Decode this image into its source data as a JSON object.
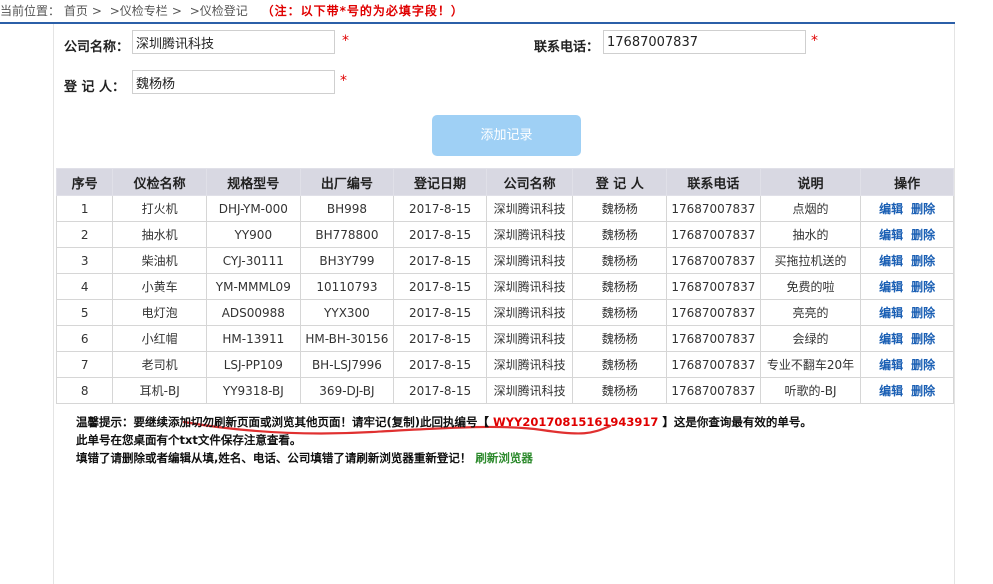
{
  "breadcrumb": {
    "label": "当前位置：",
    "items": [
      "首页",
      ">仪检专栏",
      ">仪检登记"
    ],
    "note": "（注：以下带*号的为必填字段！）"
  },
  "form": {
    "company_label": "公司名称：",
    "company_value": "深圳腾讯科技",
    "phone_label": "联系电话：",
    "phone_value": "17687007837",
    "registrant_label": "登 记 人：",
    "registrant_value": "魏杨杨",
    "required_mark": "*",
    "add_button": "添加记录"
  },
  "table": {
    "headers": [
      "序号",
      "仪检名称",
      "规格型号",
      "出厂编号",
      "登记日期",
      "公司名称",
      "登 记 人",
      "联系电话",
      "说明",
      "操作"
    ],
    "edit_label": "编辑",
    "delete_label": "删除",
    "rows": [
      [
        "1",
        "打火机",
        "DHJ-YM-000",
        "BH998",
        "2017-8-15",
        "深圳腾讯科技",
        "魏杨杨",
        "17687007837",
        "点烟的"
      ],
      [
        "2",
        "抽水机",
        "YY900",
        "BH778800",
        "2017-8-15",
        "深圳腾讯科技",
        "魏杨杨",
        "17687007837",
        "抽水的"
      ],
      [
        "3",
        "柴油机",
        "CYJ-30111",
        "BH3Y799",
        "2017-8-15",
        "深圳腾讯科技",
        "魏杨杨",
        "17687007837",
        "买拖拉机送的"
      ],
      [
        "4",
        "小黄车",
        "YM-MMML09",
        "10110793",
        "2017-8-15",
        "深圳腾讯科技",
        "魏杨杨",
        "17687007837",
        "免费的啦"
      ],
      [
        "5",
        "电灯泡",
        "ADS00988",
        "YYX300",
        "2017-8-15",
        "深圳腾讯科技",
        "魏杨杨",
        "17687007837",
        "亮亮的"
      ],
      [
        "6",
        "小红帽",
        "HM-13911",
        "HM-BH-30156",
        "2017-8-15",
        "深圳腾讯科技",
        "魏杨杨",
        "17687007837",
        "会绿的"
      ],
      [
        "7",
        "老司机",
        "LSJ-PP109",
        "BH-LSJ7996",
        "2017-8-15",
        "深圳腾讯科技",
        "魏杨杨",
        "17687007837",
        "专业不翻车20年"
      ],
      [
        "8",
        "耳机-BJ",
        "YY9318-BJ",
        "369-DJ-BJ",
        "2017-8-15",
        "深圳腾讯科技",
        "魏杨杨",
        "17687007837",
        "听歌的-BJ"
      ]
    ]
  },
  "tips": {
    "line1_prefix": "温馨提示：要继续添加切勿刷新页面或浏览其他页面！请牢记(复制)此回执编号【",
    "receipt_code": "WYY20170815161943917",
    "line1_suffix": "】这是你查询最有效的单号。",
    "line2": "此单号在您桌面有个txt文件保存注意查看。",
    "line3": "填错了请删除或者编辑从填,姓名、电话、公司填错了请刷新浏览器重新登记！",
    "refresh_link": "刷新浏览器"
  },
  "colors": {
    "accent_blue": "#2b5fa8",
    "button_bg": "#9fd0f5",
    "required_red": "#e00000",
    "link_green": "#2e8b2e",
    "header_bg": "#d8d8e2"
  }
}
